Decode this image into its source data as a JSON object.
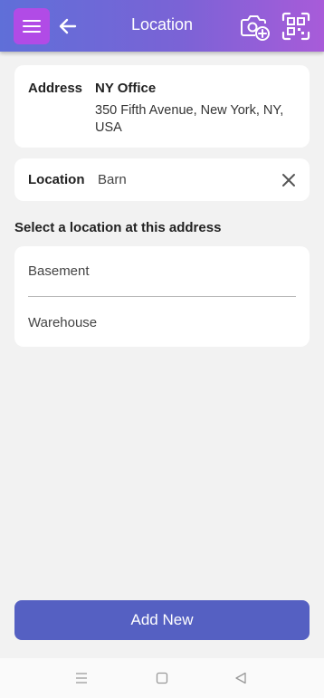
{
  "header": {
    "title": "Location",
    "icons": {
      "menu": "hamburger-icon",
      "back": "arrow-left-icon",
      "camera": "camera-add-icon",
      "scan": "qr-scan-icon"
    },
    "colors": {
      "gradient_start": "#5f6fd8",
      "gradient_end": "#a85bd9",
      "menu_button": "#b14be6"
    }
  },
  "address_card": {
    "label": "Address",
    "name": "NY Office",
    "street": "350 Fifth Avenue, New York, NY, USA"
  },
  "location_card": {
    "label": "Location",
    "value": "Barn",
    "clear_icon": "close-icon"
  },
  "select_section": {
    "title": "Select a location at this address",
    "items": [
      {
        "label": "Basement"
      },
      {
        "label": "Warehouse"
      }
    ]
  },
  "footer": {
    "add_new_label": "Add New",
    "button_color": "#5560c2"
  },
  "system_nav": {
    "icons": [
      "menu-icon",
      "home-icon",
      "back-icon"
    ]
  }
}
